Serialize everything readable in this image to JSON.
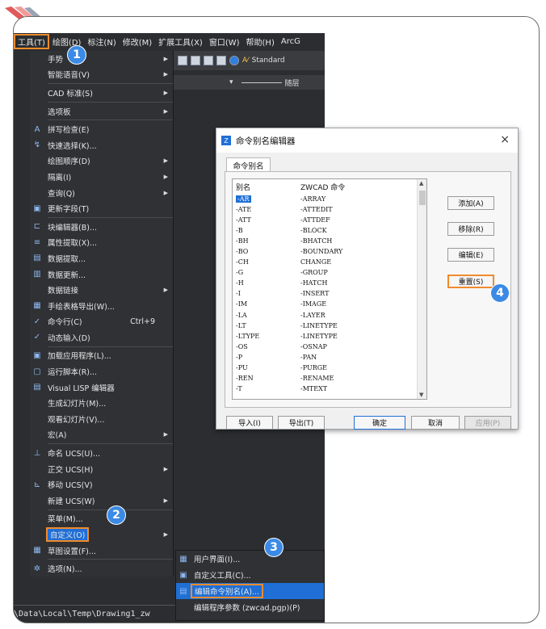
{
  "menubar": [
    "工具(T)",
    "绘图(D)",
    "标注(N)",
    "修改(M)",
    "扩展工具(X)",
    "窗口(W)",
    "帮助(H)",
    "ArcG"
  ],
  "toolbar": {
    "style": "Standard",
    "layer": "随层"
  },
  "menu": {
    "items": [
      {
        "icon": "",
        "label": "手势",
        "arrow": true
      },
      {
        "icon": "",
        "label": "智能语音(V)",
        "arrow": true
      },
      {
        "sep": true
      },
      {
        "icon": "",
        "label": "CAD 标准(S)",
        "arrow": true
      },
      {
        "sep": true
      },
      {
        "icon": "",
        "label": "选项板",
        "arrow": true
      },
      {
        "sep": true
      },
      {
        "icon": "A",
        "label": "拼写检查(E)"
      },
      {
        "icon": "↯",
        "label": "快速选择(K)..."
      },
      {
        "icon": "",
        "label": "绘图顺序(D)",
        "arrow": true
      },
      {
        "icon": "",
        "label": "隔离(I)",
        "arrow": true
      },
      {
        "icon": "",
        "label": "查询(Q)",
        "arrow": true
      },
      {
        "icon": "▣",
        "label": "更新字段(T)"
      },
      {
        "sep": true
      },
      {
        "icon": "⊏",
        "label": "块编辑器(B)..."
      },
      {
        "icon": "≡",
        "label": "属性提取(X)..."
      },
      {
        "icon": "▤",
        "label": "数据提取..."
      },
      {
        "icon": "▥",
        "label": "数据更新..."
      },
      {
        "icon": "",
        "label": "数据链接",
        "arrow": true
      },
      {
        "icon": "▦",
        "label": "手绘表格导出(W)..."
      },
      {
        "icon": "✓",
        "label": "命令行(C)",
        "shortcut": "Ctrl+9"
      },
      {
        "icon": "✓",
        "label": "动态输入(D)"
      },
      {
        "sep": true
      },
      {
        "icon": "▣",
        "label": "加载应用程序(L)..."
      },
      {
        "icon": "▢",
        "label": "运行脚本(R)..."
      },
      {
        "icon": "▤",
        "label": "Visual LISP 编辑器"
      },
      {
        "icon": "",
        "label": "生成幻灯片(M)..."
      },
      {
        "icon": "",
        "label": "观看幻灯片(V)..."
      },
      {
        "icon": "",
        "label": "宏(A)",
        "arrow": true
      },
      {
        "sep": true
      },
      {
        "icon": "⊥",
        "label": "命名 UCS(U)..."
      },
      {
        "icon": "",
        "label": "正交 UCS(H)",
        "arrow": true
      },
      {
        "icon": "⊾",
        "label": "移动 UCS(V)"
      },
      {
        "icon": "",
        "label": "新建 UCS(W)",
        "arrow": true
      },
      {
        "sep": true
      },
      {
        "icon": "",
        "label": "菜单(M)..."
      },
      {
        "icon": "",
        "label": "自定义(O)",
        "arrow": true,
        "highlight": true
      },
      {
        "icon": "▦",
        "label": "草图设置(F)..."
      },
      {
        "sep": true
      },
      {
        "icon": "✲",
        "label": "选项(N)..."
      }
    ]
  },
  "submenu": [
    {
      "label": "用户界面(I)..."
    },
    {
      "label": "自定义工具(C)..."
    },
    {
      "label": "编辑命令别名(A)...",
      "selected": true
    },
    {
      "label": "编辑程序参数 (zwcad.pgp)(P)"
    }
  ],
  "path_text": "\\Data\\Local\\Temp\\Drawing1_zw",
  "badges": [
    "1",
    "2",
    "3",
    "4"
  ],
  "dialog": {
    "title": "命令别名编辑器",
    "close": "×",
    "tab": "命令别名",
    "col_alias": "别名",
    "col_command": "ZWCAD 命令",
    "rows": [
      [
        "-AR",
        "-ARRAY"
      ],
      [
        "-ATE",
        "-ATTEDIT"
      ],
      [
        "-ATT",
        "-ATTDEF"
      ],
      [
        "-B",
        "-BLOCK"
      ],
      [
        "-BH",
        "-BHATCH"
      ],
      [
        "-BO",
        "-BOUNDARY"
      ],
      [
        "-CH",
        "CHANGE"
      ],
      [
        "-G",
        "-GROUP"
      ],
      [
        "-H",
        "-HATCH"
      ],
      [
        "-I",
        "-INSERT"
      ],
      [
        "-IM",
        "-IMAGE"
      ],
      [
        "-LA",
        "-LAYER"
      ],
      [
        "-LT",
        "-LINETYPE"
      ],
      [
        "-LTYPE",
        "-LINETYPE"
      ],
      [
        "-OS",
        "-OSNAP"
      ],
      [
        "-P",
        "-PAN"
      ],
      [
        "-PU",
        "-PURGE"
      ],
      [
        "-REN",
        "-RENAME"
      ],
      [
        "-T",
        "-MTEXT"
      ]
    ],
    "buttons": {
      "add": "添加(A)",
      "remove": "移除(R)",
      "edit": "编辑(E)",
      "reset": "重置(S)"
    },
    "bottom": {
      "import": "导入(I)",
      "export": "导出(T)",
      "ok": "确定",
      "cancel": "取消",
      "apply": "应用(P)"
    }
  },
  "colors": {
    "accent": "#ef8b2c",
    "badge": "#3b8ae6",
    "highlight": "#1f6fd6"
  }
}
